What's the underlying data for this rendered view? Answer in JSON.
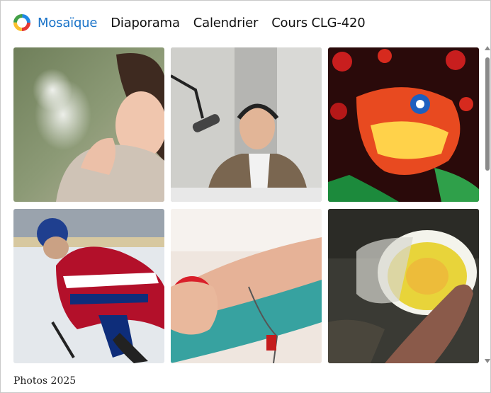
{
  "nav": {
    "items": [
      {
        "label": "Mosaïque",
        "active": true
      },
      {
        "label": "Diaporama",
        "active": false
      },
      {
        "label": "Calendrier",
        "active": false
      },
      {
        "label": "Cours CLG-420",
        "active": false
      }
    ],
    "logo_colors": [
      "#e53935",
      "#fbc02d",
      "#43a047",
      "#1e88e5"
    ],
    "active_color": "#1a73c8"
  },
  "grid": {
    "photos": [
      {
        "subject": "woman-breath-cold"
      },
      {
        "subject": "man-podcast-microphone"
      },
      {
        "subject": "chinese-dragon-lantern"
      },
      {
        "subject": "hockey-player-ice"
      },
      {
        "subject": "blood-donation-arm"
      },
      {
        "subject": "microscope-sample-light"
      }
    ]
  },
  "footer": {
    "caption": "Photos 2025"
  }
}
